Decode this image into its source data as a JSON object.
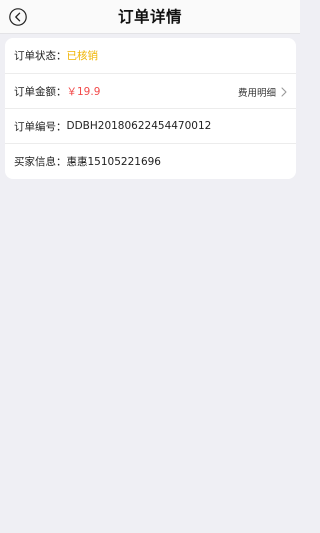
{
  "header": {
    "title": "订单详情",
    "back_icon": "back-circle-icon"
  },
  "order": {
    "status_label": "订单状态：",
    "status_value": "已核销",
    "amount_label": "订单金额：",
    "amount_value": "￥19.9",
    "fee_detail_label": "费用明细",
    "number_label": "订单编号：",
    "number_value": "DDBH20180622454470012",
    "buyer_label": "买家信息：",
    "buyer_value": "惠惠15105221696"
  },
  "colors": {
    "status": "#f0b400",
    "price": "#f24b4b",
    "background": "#efeff4"
  }
}
